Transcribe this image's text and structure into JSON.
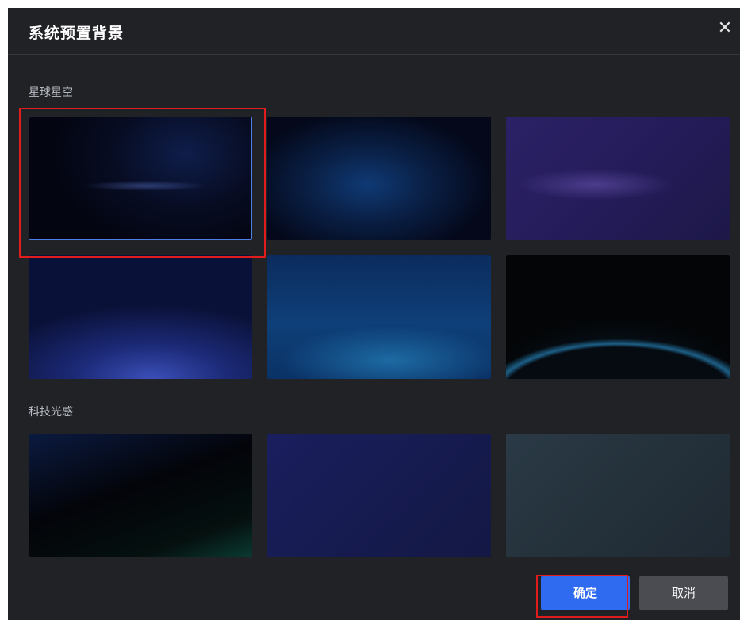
{
  "dialog": {
    "title": "系统预置背景",
    "close_symbol": "✕"
  },
  "sections": [
    {
      "label": "星球星空",
      "thumbnails": [
        {
          "name": "starry-1",
          "selected": true
        },
        {
          "name": "starry-2",
          "selected": false
        },
        {
          "name": "starry-3",
          "selected": false
        },
        {
          "name": "starry-4",
          "selected": false
        },
        {
          "name": "starry-5",
          "selected": false
        },
        {
          "name": "starry-6",
          "selected": false
        }
      ]
    },
    {
      "label": "科技光感",
      "thumbnails": [
        {
          "name": "tech-1",
          "selected": false
        },
        {
          "name": "tech-2",
          "selected": false
        },
        {
          "name": "tech-3",
          "selected": false
        }
      ]
    }
  ],
  "footer": {
    "confirm_label": "确定",
    "cancel_label": "取消"
  },
  "colors": {
    "dialog_bg": "#212226",
    "primary": "#2f6bf0",
    "highlight_box": "#e01c1c"
  }
}
